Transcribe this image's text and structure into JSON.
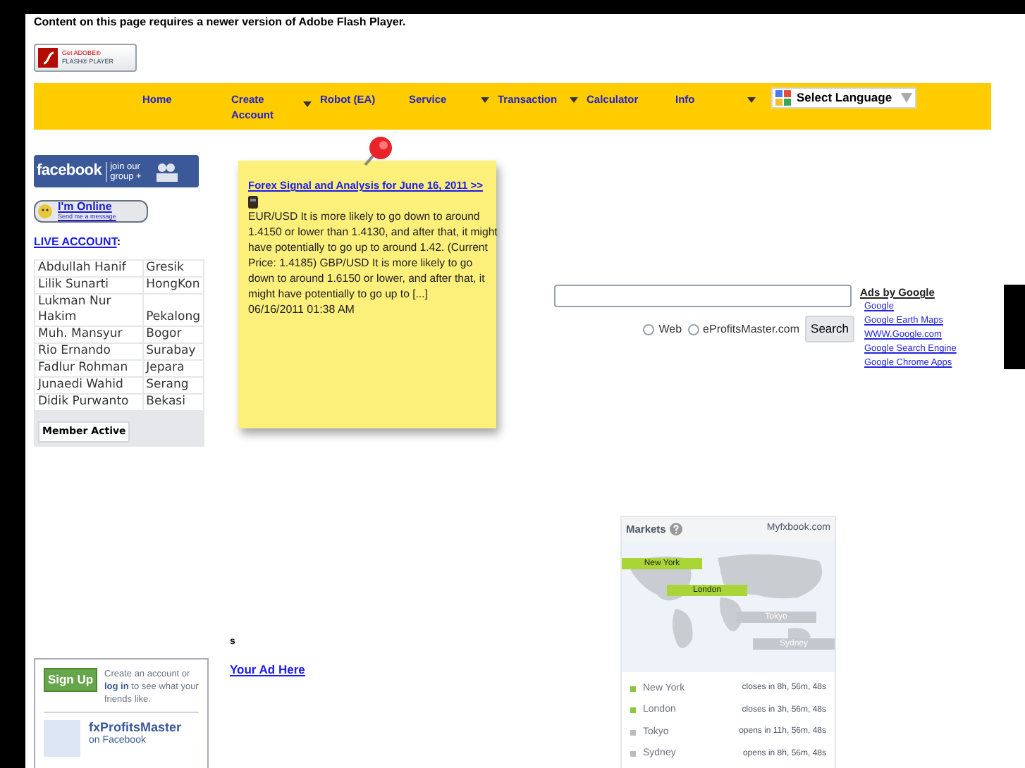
{
  "flash_notice": {
    "text": "Content on this page requires a newer version of Adobe Flash Player.",
    "badge_small": "Get ADOBE®",
    "badge_large": "FLASH® PLAYER"
  },
  "nav": {
    "items": [
      {
        "label": "Home",
        "has_dropdown": false
      },
      {
        "label": "Create Account",
        "has_dropdown": true
      },
      {
        "label": "Robot (EA)",
        "has_dropdown": false
      },
      {
        "label": "Service",
        "has_dropdown": true
      },
      {
        "label": "Transaction",
        "has_dropdown": true
      },
      {
        "label": "Calculator",
        "has_dropdown": false
      },
      {
        "label": "Info",
        "has_dropdown": true
      }
    ],
    "language": "Select Language"
  },
  "facebook_banner": {
    "brand": "facebook",
    "action": "join our group +"
  },
  "online_badge": {
    "title": "I'm Online",
    "subtitle": "Send me a message"
  },
  "live_account": {
    "link": "LIVE ACCOUNT",
    "suffix": ":"
  },
  "members": [
    {
      "name": "Abdullah Hanif",
      "city": "Gresik"
    },
    {
      "name": "Lilik Sunarti",
      "city": "HongKon"
    },
    {
      "name": "Lukman Nur Hakim",
      "city": "Pekalong"
    },
    {
      "name": "Muh. Mansyur",
      "city": "Bogor"
    },
    {
      "name": "Rio Ernando",
      "city": "Surabay"
    },
    {
      "name": "Fadlur Rohman",
      "city": "Jepara"
    },
    {
      "name": "Junaedi Wahid",
      "city": "Serang"
    },
    {
      "name": "Didik Purwanto",
      "city": "Bekasi"
    }
  ],
  "member_active": "Member Active",
  "note": {
    "title": "Forex Signal and Analysis for June 16, 2011 >>",
    "body": "EUR/USD It is more likely to go down to around 1.4150 or lower than 1.4130, and after that, it might have potentially to go up to around 1.42. (Current Price: 1.4185) GBP/USD It is more likely to go down to around 1.6150 or lower, and after that, it might have potentially to go up to [...]",
    "date": "06/16/2011 01:38 AM"
  },
  "search": {
    "options": [
      {
        "label": "Web",
        "selected": false
      },
      {
        "label": "eProfitsMaster.com",
        "selected": false
      }
    ],
    "button": "Search"
  },
  "ads": {
    "heading": "Ads by Google",
    "links": [
      "Google",
      "Google Earth Maps",
      "WWW.Google.com",
      "Google Search Engine",
      "Google Chrome Apps"
    ]
  },
  "stray_text": "s",
  "ad_link": "Your Ad Here",
  "fb_widget": {
    "signup": "Sign Up",
    "text": "Create an account or **log in** to see what your friends like.",
    "page_name": "fxProfitsMaster",
    "page_sub": "on Facebook"
  },
  "markets": {
    "title": "Markets",
    "source": "Myfxbook.com",
    "sessions": [
      {
        "map_label": "New York",
        "name": "New York",
        "open": true,
        "status": "closes in 8h, 56m, 48s"
      },
      {
        "map_label": "London",
        "name": "London",
        "open": true,
        "status": "closes in 3h, 56m, 48s"
      },
      {
        "map_label": "Tokyo",
        "name": "Tokyo",
        "open": false,
        "status": "opens in 11h, 56m, 48s"
      },
      {
        "map_label": "Sydney",
        "name": "Sydney",
        "open": false,
        "status": "opens in 8h, 56m, 48s"
      }
    ]
  }
}
